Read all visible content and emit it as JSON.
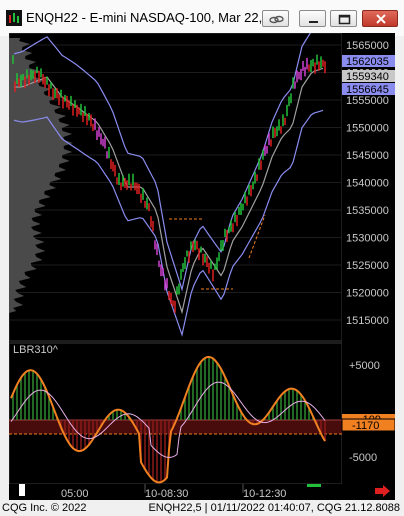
{
  "window": {
    "title": "ENQH22 - E-mini NASDAQ-100, Mar 22, 5 ...",
    "buttons": [
      "link",
      "minimize",
      "maximize",
      "close"
    ]
  },
  "price_axis": {
    "labels": [
      "1565000",
      "1560000",
      "1555000",
      "1550000",
      "1545000",
      "1540000",
      "1535000",
      "1530000",
      "1525000",
      "1520000",
      "1515000"
    ],
    "flags": [
      {
        "text": "1562035",
        "color": "#8a8cf0",
        "textcolor": "#000000"
      },
      {
        "text": "1559340",
        "color": "#c8c8c8",
        "textcolor": "#000000"
      },
      {
        "text": "1556645",
        "color": "#8a8cf0",
        "textcolor": "#000000"
      }
    ]
  },
  "indicator": {
    "name": "LBR310^",
    "axis_labels": [
      "+5000",
      "0",
      "-5000"
    ],
    "flags": [
      {
        "text": "-109",
        "color": "#f08020"
      },
      {
        "text": "-1170",
        "color": "#f08020"
      }
    ]
  },
  "time_axis": {
    "labels": [
      "05:00",
      "10-08:30",
      "10-12:30"
    ]
  },
  "status": {
    "left": "CQG Inc. © 2022",
    "right": "ENQH22,5 | 01/11/2022 01:40:07, CQG 21.12.8088"
  },
  "colors": {
    "up_bar": "#22c03a",
    "down_bar": "#e02020",
    "bollinger": "#8a8cf0",
    "mid_band": "#a0a0a0",
    "osc_line": "#f08020",
    "osc_hist_up": "#2e8b2e",
    "osc_hist_down": "#8b1a1a",
    "signal_line": "#e8b0e8"
  }
}
